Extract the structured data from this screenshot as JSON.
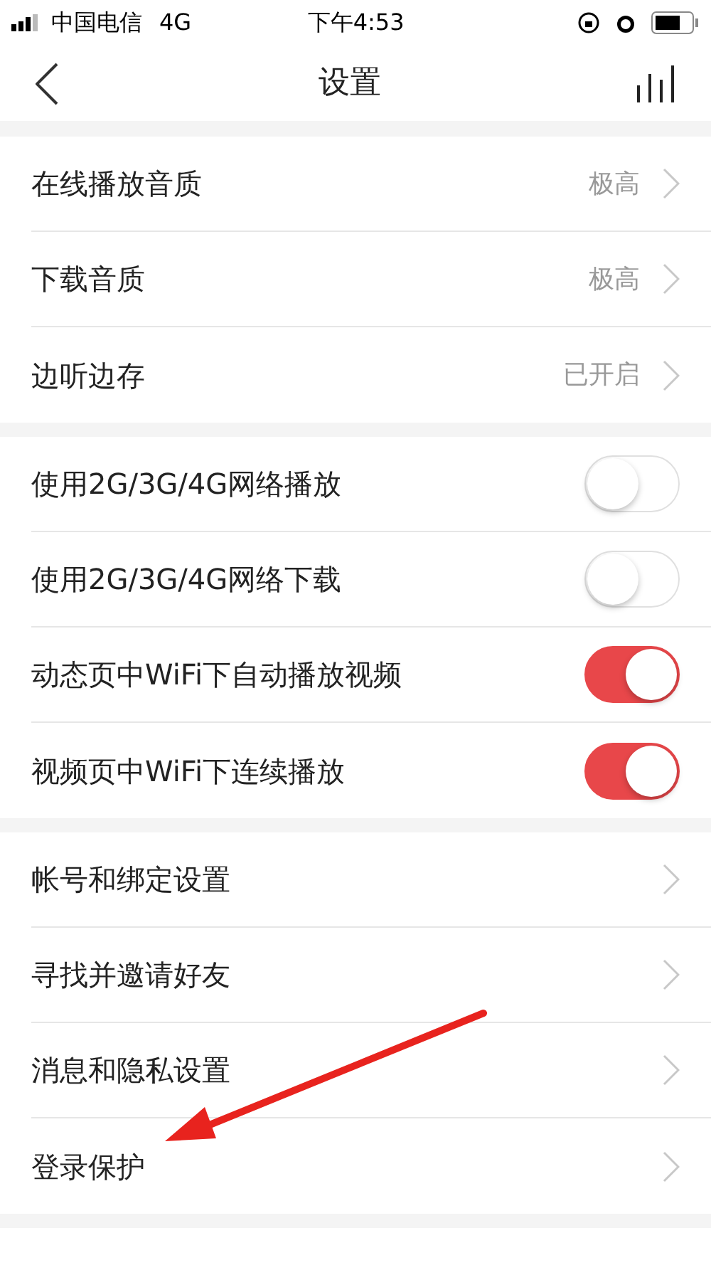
{
  "status_bar": {
    "carrier": "中国电信",
    "network": "4G",
    "time": "下午4:53"
  },
  "nav": {
    "title": "设置"
  },
  "sections": [
    {
      "items": [
        {
          "kind": "link",
          "label": "在线播放音质",
          "value": "极高"
        },
        {
          "kind": "link",
          "label": "下载音质",
          "value": "极高"
        },
        {
          "kind": "link",
          "label": "边听边存",
          "value": "已开启"
        }
      ]
    },
    {
      "items": [
        {
          "kind": "toggle",
          "label": "使用2G/3G/4G网络播放",
          "on": false
        },
        {
          "kind": "toggle",
          "label": "使用2G/3G/4G网络下载",
          "on": false
        },
        {
          "kind": "toggle",
          "label": "动态页中WiFi下自动播放视频",
          "on": true
        },
        {
          "kind": "toggle",
          "label": "视频页中WiFi下连续播放",
          "on": true
        }
      ]
    },
    {
      "items": [
        {
          "kind": "link",
          "label": "帐号和绑定设置"
        },
        {
          "kind": "link",
          "label": "寻找并邀请好友"
        },
        {
          "kind": "link",
          "label": "消息和隐私设置"
        },
        {
          "kind": "link",
          "label": "登录保护"
        }
      ]
    }
  ]
}
